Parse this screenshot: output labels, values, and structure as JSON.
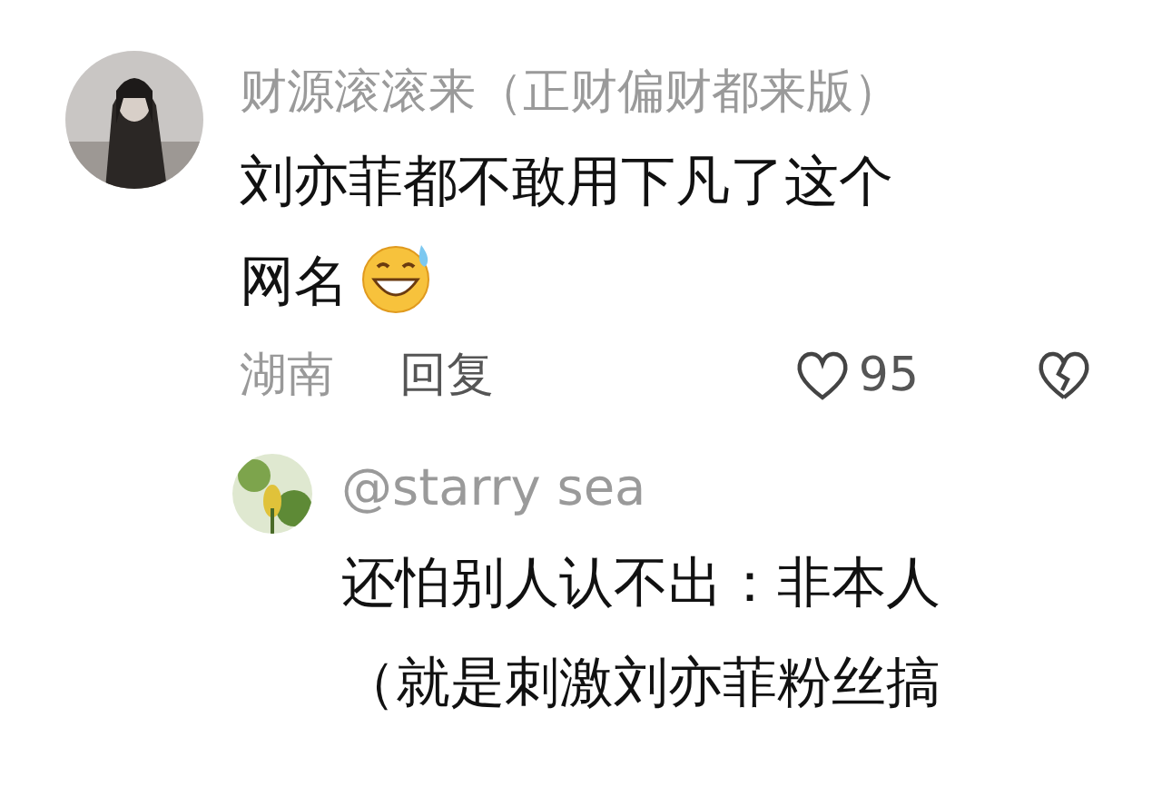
{
  "comment": {
    "username": "财源滚滚来（正财偏财都来版）",
    "text": "刘亦菲都不敢用下凡了这个网名",
    "location": "湖南",
    "reply_action": "回复",
    "like_count": "95",
    "liked": false
  },
  "reply": {
    "username": "@starry sea",
    "text": "还怕别人认不出：非本人（就是刺激刘亦菲粉丝搞"
  }
}
